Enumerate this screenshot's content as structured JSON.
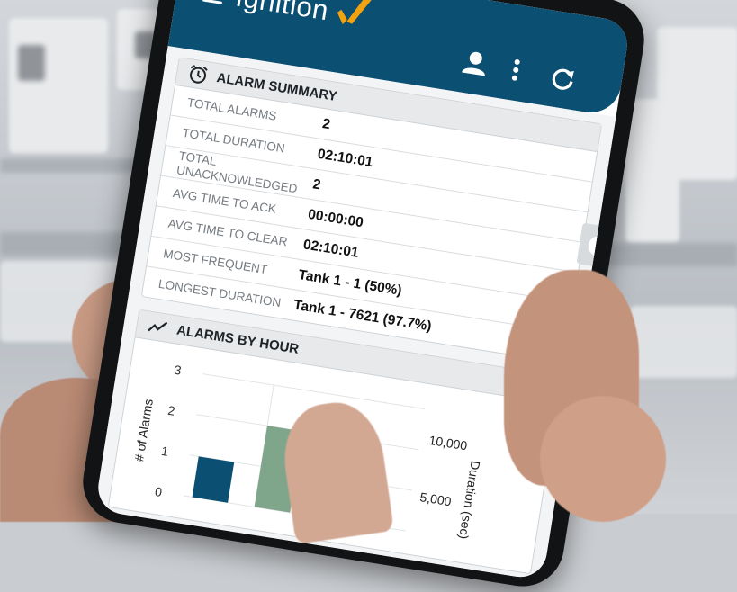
{
  "app": {
    "logo_text": "Ignition",
    "logo_mark": "!"
  },
  "colors": {
    "appbar": "#0b4f73",
    "logo_accent": "#f2a20e",
    "bar_primary": "#0b4f73",
    "bar_secondary": "#7fa58a"
  },
  "alarm_summary": {
    "title": "ALARM SUMMARY",
    "rows": [
      {
        "label": "TOTAL ALARMS",
        "value": "2"
      },
      {
        "label": "TOTAL DURATION",
        "value": "02:10:01"
      },
      {
        "label": "TOTAL UNACKNOWLEDGED",
        "value": "2"
      },
      {
        "label": "AVG TIME TO ACK",
        "value": "00:00:00"
      },
      {
        "label": "AVG TIME TO CLEAR",
        "value": "02:10:01"
      },
      {
        "label": "MOST FREQUENT",
        "value": "Tank 1 - 1 (50%)"
      },
      {
        "label": "LONGEST DURATION",
        "value": "Tank 1 - 7621 (97.7%)"
      }
    ]
  },
  "alarms_by_hour": {
    "title": "ALARMS BY HOUR",
    "chart_data": {
      "type": "bar",
      "ylabel": "# of Alarms",
      "y2label": "Duration (sec)",
      "ylim": [
        0,
        3
      ],
      "y_ticks": [
        "0",
        "1",
        "2",
        "3"
      ],
      "y2_ticks": [
        "5,000",
        "10,000"
      ],
      "series": [
        {
          "values": [
            1,
            2
          ]
        }
      ]
    }
  }
}
